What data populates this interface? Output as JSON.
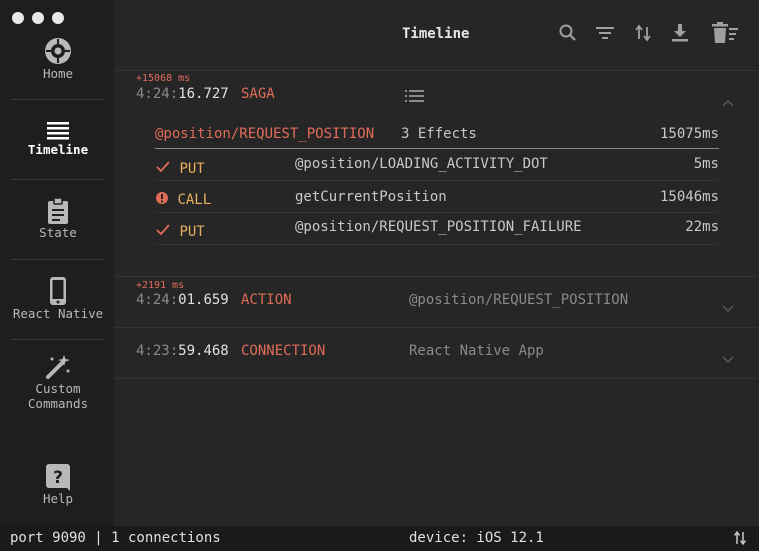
{
  "sidebar": {
    "items": [
      {
        "label": "Home",
        "icon": "reactotron-logo-icon"
      },
      {
        "label": "Timeline",
        "icon": "timeline-icon"
      },
      {
        "label": "State",
        "icon": "clipboard-icon"
      },
      {
        "label": "React Native",
        "icon": "phone-icon"
      },
      {
        "label": "Custom Commands",
        "icon": "magic-wand-icon"
      },
      {
        "label": "Help",
        "icon": "help-icon"
      }
    ]
  },
  "header": {
    "title": "Timeline"
  },
  "timeline": {
    "saga": {
      "delta": "+15068 ms",
      "time_dim": "4:24:",
      "time_bright": "16.727",
      "kind": "SAGA",
      "head": {
        "name": "@position/REQUEST_POSITION",
        "effects": "3 Effects",
        "ms": "15075ms"
      },
      "effects": [
        {
          "type": "PUT",
          "name": "@position/LOADING_ACTIVITY_DOT",
          "ms": "5ms"
        },
        {
          "type": "CALL",
          "name": "getCurrentPosition",
          "ms": "15046ms"
        },
        {
          "type": "PUT",
          "name": "@position/REQUEST_POSITION_FAILURE",
          "ms": "22ms"
        }
      ]
    },
    "action": {
      "delta": "+2191 ms",
      "time_dim": "4:24:",
      "time_bright": "01.659",
      "kind": "ACTION",
      "summary": "@position/REQUEST_POSITION"
    },
    "connection": {
      "time_dim": "4:23:",
      "time_bright": "59.468",
      "kind": "CONNECTION",
      "summary": "React Native App"
    }
  },
  "status": {
    "port": "port 9090 | 1 connections",
    "device": "device: iOS 12.1"
  },
  "colors": {
    "accent": "#e06c58",
    "effect": "#e8b060",
    "error": "#e06c58"
  }
}
